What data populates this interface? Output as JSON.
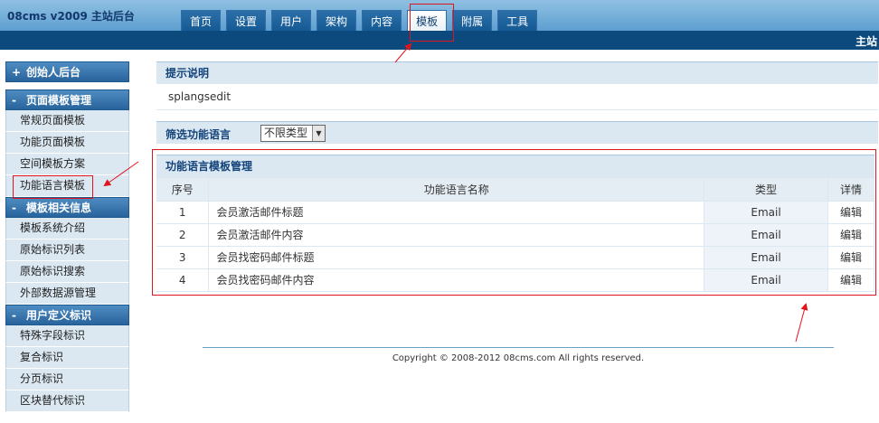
{
  "header": {
    "logo_version": "08cms v2009",
    "logo_title": "主站后台",
    "subbar_text": "主站",
    "tabs": [
      {
        "label": "首页"
      },
      {
        "label": "设置"
      },
      {
        "label": "用户"
      },
      {
        "label": "架构"
      },
      {
        "label": "内容"
      },
      {
        "label": "模板",
        "active": true
      },
      {
        "label": "附属"
      },
      {
        "label": "工具"
      }
    ]
  },
  "sidebar": {
    "founder": {
      "sign": "+",
      "label": "创始人后台"
    },
    "sections": [
      {
        "sign": "-",
        "label": "页面模板管理",
        "items": [
          "常规页面模板",
          "功能页面模板",
          "空间模板方案",
          "功能语言模板"
        ]
      },
      {
        "sign": "-",
        "label": "模板相关信息",
        "items": [
          "模板系统介绍",
          "原始标识列表",
          "原始标识搜索",
          "外部数据源管理"
        ]
      },
      {
        "sign": "-",
        "label": "用户定义标识",
        "items": [
          "特殊字段标识",
          "复合标识",
          "分页标识",
          "区块替代标识"
        ]
      }
    ]
  },
  "tip": {
    "title": "提示说明",
    "text": "splangsedit"
  },
  "filter": {
    "label": "筛选功能语言",
    "selected": "不限类型"
  },
  "table": {
    "title": "功能语言模板管理",
    "columns": [
      "序号",
      "功能语言名称",
      "类型",
      "详情"
    ],
    "rows": [
      {
        "no": "1",
        "name": "会员激活邮件标题",
        "type": "Email",
        "action": "编辑"
      },
      {
        "no": "2",
        "name": "会员激活邮件内容",
        "type": "Email",
        "action": "编辑"
      },
      {
        "no": "3",
        "name": "会员找密码邮件标题",
        "type": "Email",
        "action": "编辑"
      },
      {
        "no": "4",
        "name": "会员找密码邮件内容",
        "type": "Email",
        "action": "编辑"
      }
    ]
  },
  "footer": {
    "text": "Copyright © 2008-2012 08cms.com All rights reserved."
  },
  "colors": {
    "annotation": "#e0141d",
    "header": "#0c4a7e",
    "panel": "#dbe8f2"
  }
}
